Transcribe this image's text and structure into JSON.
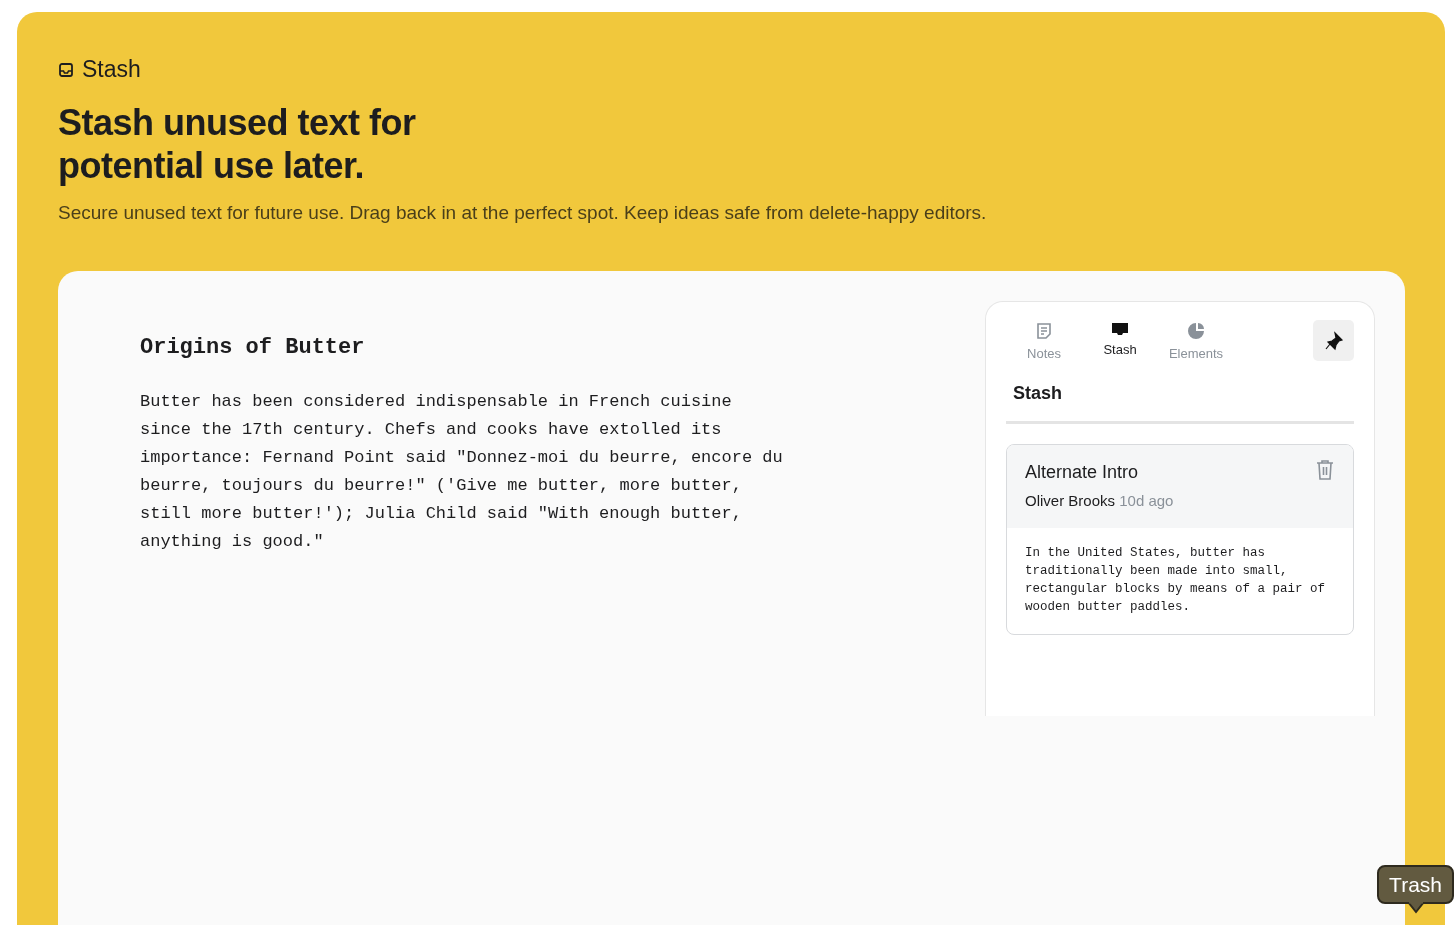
{
  "header": {
    "label": "Stash",
    "title": "Stash unused text for potential use later.",
    "subtitle": "Secure unused text for future use. Drag back in at the perfect spot. Keep ideas safe from delete-happy editors."
  },
  "document": {
    "heading": "Origins of Butter",
    "body": "Butter has been considered indispensable in French cuisine since the 17th century. Chefs and cooks have extolled its importance: Fernand Point said \"Donnez-moi du beurre, encore du beurre, toujours du beurre!\" ('Give me butter, more butter, still more butter!'); Julia Child said \"With enough butter, anything is good.\""
  },
  "sidebar": {
    "tabs": [
      {
        "label": "Notes",
        "kind": "notes",
        "selected": false
      },
      {
        "label": "Stash",
        "kind": "stash",
        "selected": true
      },
      {
        "label": "Elements",
        "kind": "elements",
        "selected": false
      }
    ],
    "title": "Stash",
    "items": [
      {
        "title": "Alternate Intro",
        "author": "Oliver Brooks",
        "time": "10d ago",
        "text": "In the United States, butter has traditionally been made into small, rectangular blocks by means of a pair of wooden butter paddles."
      }
    ]
  },
  "tooltip": "Trash"
}
